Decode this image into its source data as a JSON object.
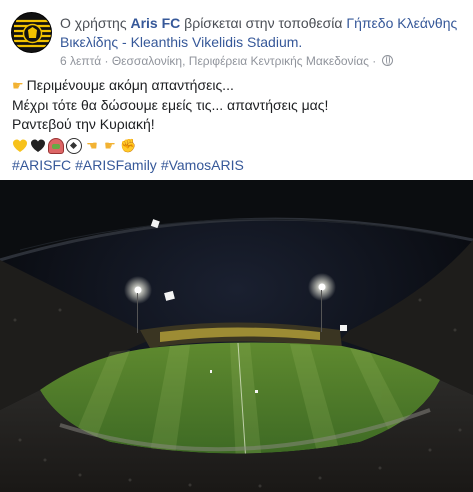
{
  "post": {
    "prefix": "Ο χρήστης",
    "page_name": "Aris FC",
    "location_text": "βρίσκεται στην τοποθεσία",
    "location_name": "Γήπεδο Κλεάνθης Βικελίδης - Kleanthis Vikelidis Stadium.",
    "time": "6 λεπτά",
    "place": "Θεσσαλονίκη, Περιφέρεια Κεντρικής Μακεδονίας",
    "privacy_icon": "globe-icon"
  },
  "body": {
    "line1": "Περιμένουμε ακόμη απαντήσεις...",
    "line2": "Μέχρι τότε θα δώσουμε εμείς τις... απαντήσεις μας!",
    "line3": "Ραντεβού την Κυριακή!",
    "emojis": [
      "yellow-heart",
      "black-heart",
      "stadium",
      "soccer-ball",
      "pointing-hand",
      "pointing-hand",
      "fist"
    ],
    "hashtags": [
      "#ARISFC",
      "#ARISFamily",
      "#VamosARIS"
    ]
  },
  "colors": {
    "link": "#365899",
    "meta": "#90949c",
    "text": "#1c1e21",
    "aris_yellow": "#f2c200"
  }
}
